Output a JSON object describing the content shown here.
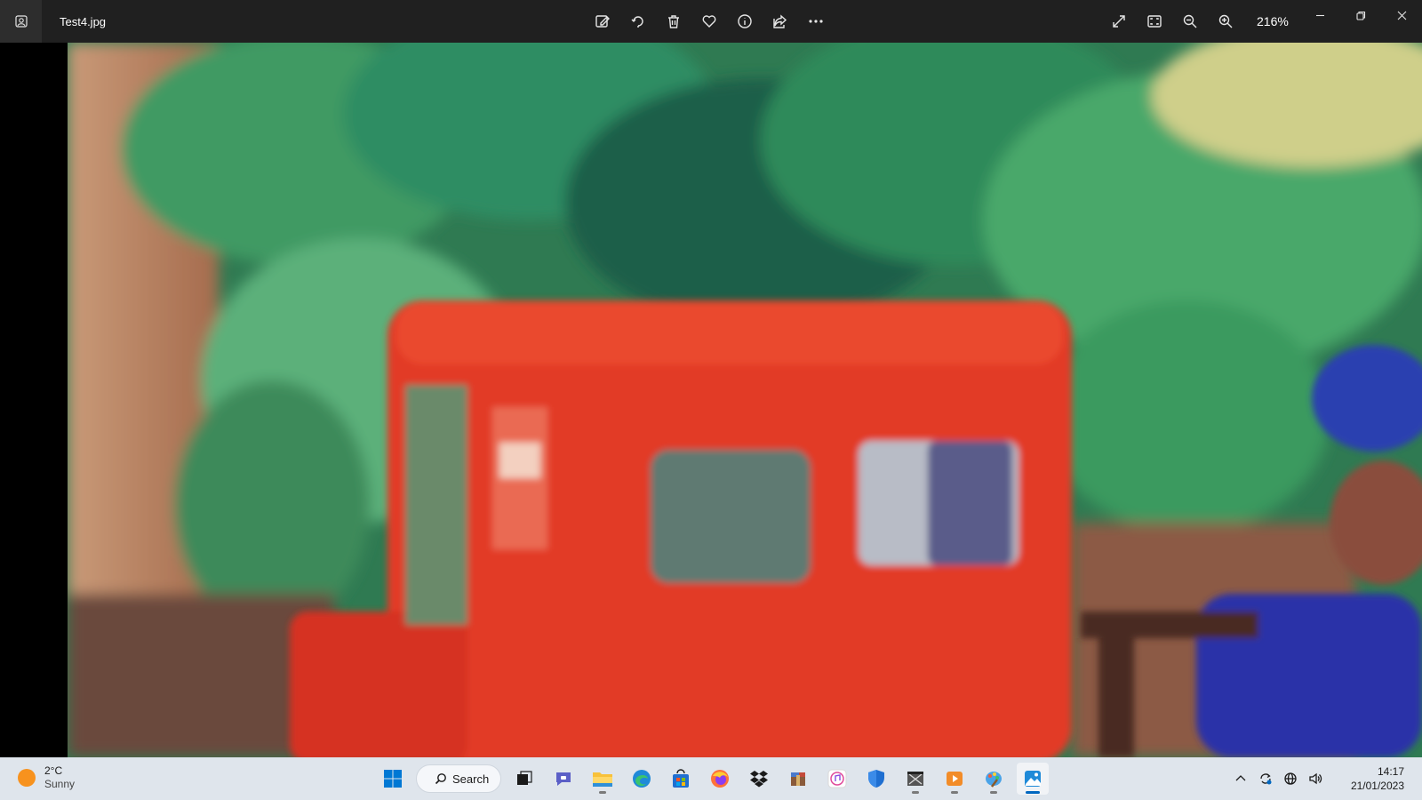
{
  "window": {
    "file_name": "Test4.jpg",
    "zoom_level": "216%"
  },
  "toolbar": {
    "center_icons": [
      "edit-icon",
      "rotate-icon",
      "delete-icon",
      "favorite-icon",
      "info-icon",
      "share-icon",
      "more-icon"
    ],
    "right_icons": [
      "fullscreen-icon",
      "fit-icon",
      "zoom-out-icon",
      "zoom-in-icon"
    ]
  },
  "taskbar": {
    "weather": {
      "temperature": "2°C",
      "condition": "Sunny"
    },
    "search_label": "Search",
    "clock": {
      "time": "14:17",
      "date": "21/01/2023"
    }
  },
  "colors": {
    "titlebar_bg": "#202020",
    "taskbar_bg": "#dfe5ec",
    "accent": "#0067c0"
  }
}
